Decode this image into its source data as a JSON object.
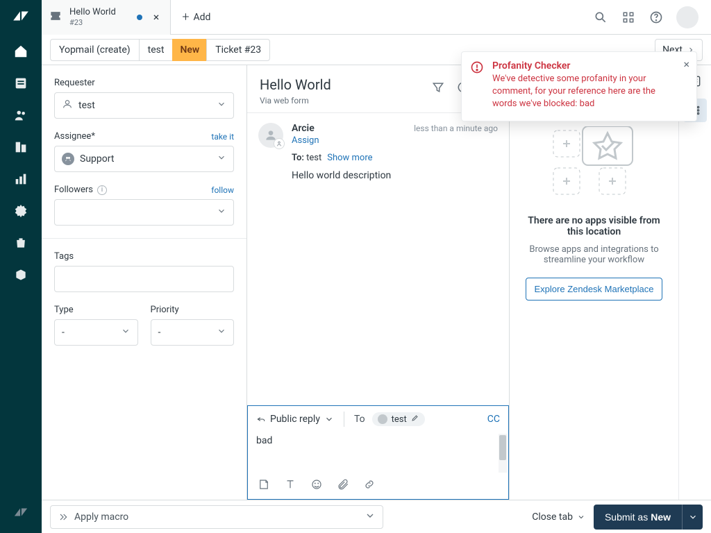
{
  "tab": {
    "title": "Hello World",
    "sub": "#23",
    "add": "Add"
  },
  "crumbs": {
    "a": "Yopmail (create)",
    "b": "test",
    "status": "New",
    "ticket": "Ticket #23",
    "next": "Next"
  },
  "form": {
    "requester_label": "Requester",
    "requester_value": "test",
    "assignee_label": "Assignee*",
    "assignee_action": "take it",
    "assignee_value": "Support",
    "followers_label": "Followers",
    "followers_action": "follow",
    "tags_label": "Tags",
    "type_label": "Type",
    "type_value": "-",
    "priority_label": "Priority",
    "priority_value": "-"
  },
  "ticket": {
    "title": "Hello World",
    "via": "Via web form",
    "sender": "Arcie",
    "time": "less than a minute ago",
    "assign": "Assign",
    "to_label": "To:",
    "to_value": "test",
    "show_more": "Show more",
    "body": "Hello world description"
  },
  "composer": {
    "reply_label": "Public reply",
    "to_label": "To",
    "chip": "test",
    "cc": "CC",
    "text": "bad"
  },
  "apps": {
    "heading": "There are no apps visible from this location",
    "sub": "Browse apps and integrations to streamline your workflow",
    "cta": "Explore Zendesk Marketplace"
  },
  "toast": {
    "title": "Profanity Checker",
    "body": "We've detective some profanity in your comment, for your reference here are the words we've blocked: bad"
  },
  "footer": {
    "macro": "Apply macro",
    "close": "Close tab",
    "submit_prefix": "Submit as ",
    "submit_status": "New"
  }
}
